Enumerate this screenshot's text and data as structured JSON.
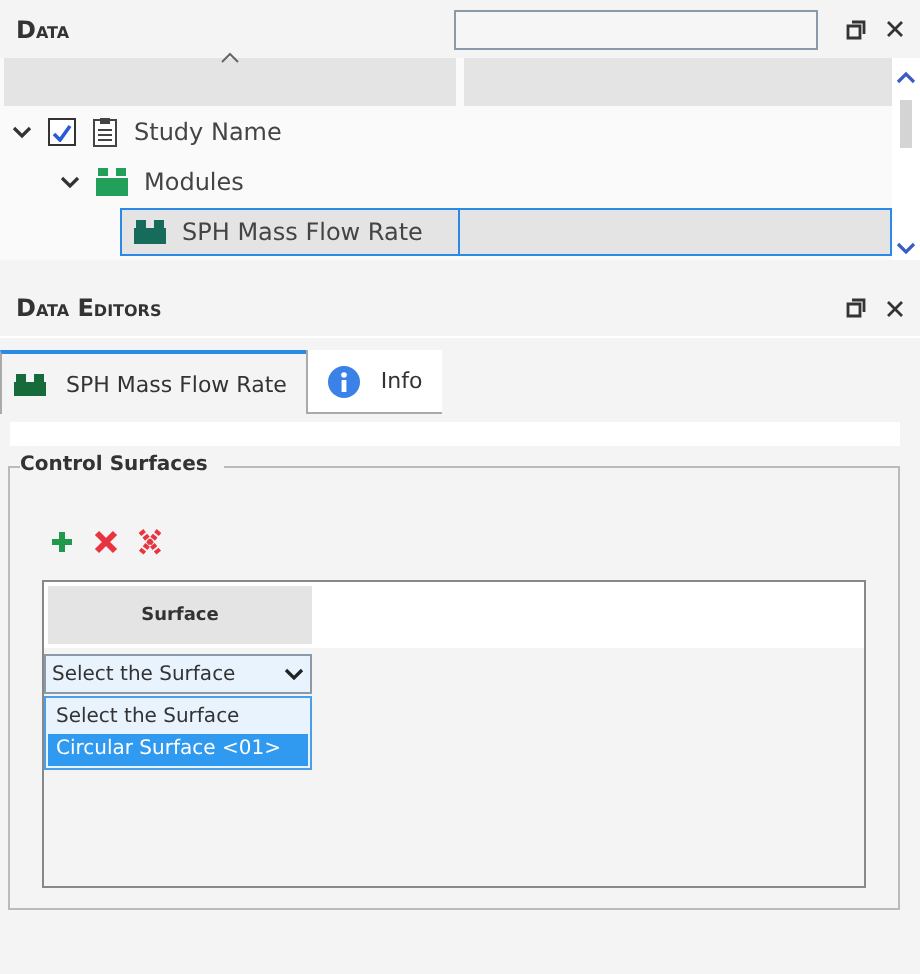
{
  "data_panel": {
    "title": "Data",
    "tree": [
      {
        "label": "Study Name",
        "kind": "study",
        "expanded": true,
        "checked": true,
        "selected": false,
        "children": [
          {
            "label": "Modules",
            "kind": "modules",
            "expanded": true,
            "selected": false,
            "children": [
              {
                "label": "SPH Mass Flow Rate",
                "kind": "module",
                "selected": true
              }
            ]
          }
        ]
      }
    ]
  },
  "editors_panel": {
    "title": "Data Editors",
    "tabs": [
      {
        "label": "SPH Mass Flow Rate",
        "kind": "module",
        "selected": true
      },
      {
        "label": "Info",
        "kind": "info",
        "selected": false
      }
    ],
    "group": {
      "title": "Control Surfaces",
      "table": {
        "columns": [
          "Surface"
        ],
        "select": {
          "value": "Select the Surface",
          "options": [
            {
              "label": "Select the Surface",
              "highlighted": false
            },
            {
              "label": "Circular Surface <01>",
              "highlighted": true
            }
          ]
        }
      }
    }
  }
}
